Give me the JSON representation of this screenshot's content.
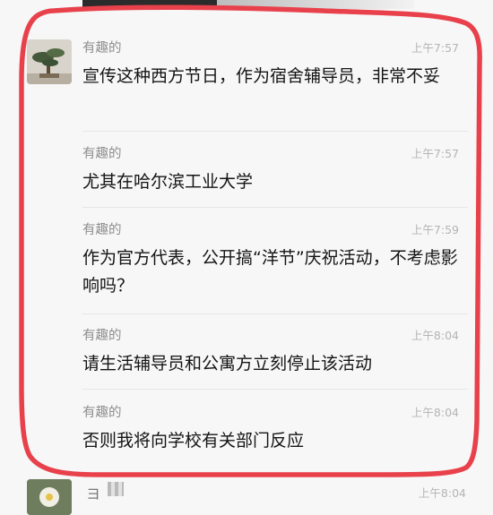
{
  "messages": [
    {
      "sender": "有趣的",
      "time": "上午7:57",
      "text": "宣传这种西方节日，作为宿舍辅导员，非常不妥"
    },
    {
      "sender": "有趣的",
      "time": "上午7:57",
      "text": "尤其在哈尔滨工业大学"
    },
    {
      "sender": "有趣的",
      "time": "上午7:59",
      "text": "作为官方代表，公开搞“洋节”庆祝活动，不考虑影响吗？"
    },
    {
      "sender": "有趣的",
      "time": "上午8:04",
      "text": "请生活辅导员和公寓方立刻停止该活动"
    },
    {
      "sender": "有趣的",
      "time": "上午8:04",
      "text": "否则我将向学校有关部门反应"
    }
  ],
  "bottom": {
    "sender": "ヨ",
    "time": "上午8:04"
  },
  "colors": {
    "highlight": "#e8414b",
    "background": "#f7f7f7"
  }
}
